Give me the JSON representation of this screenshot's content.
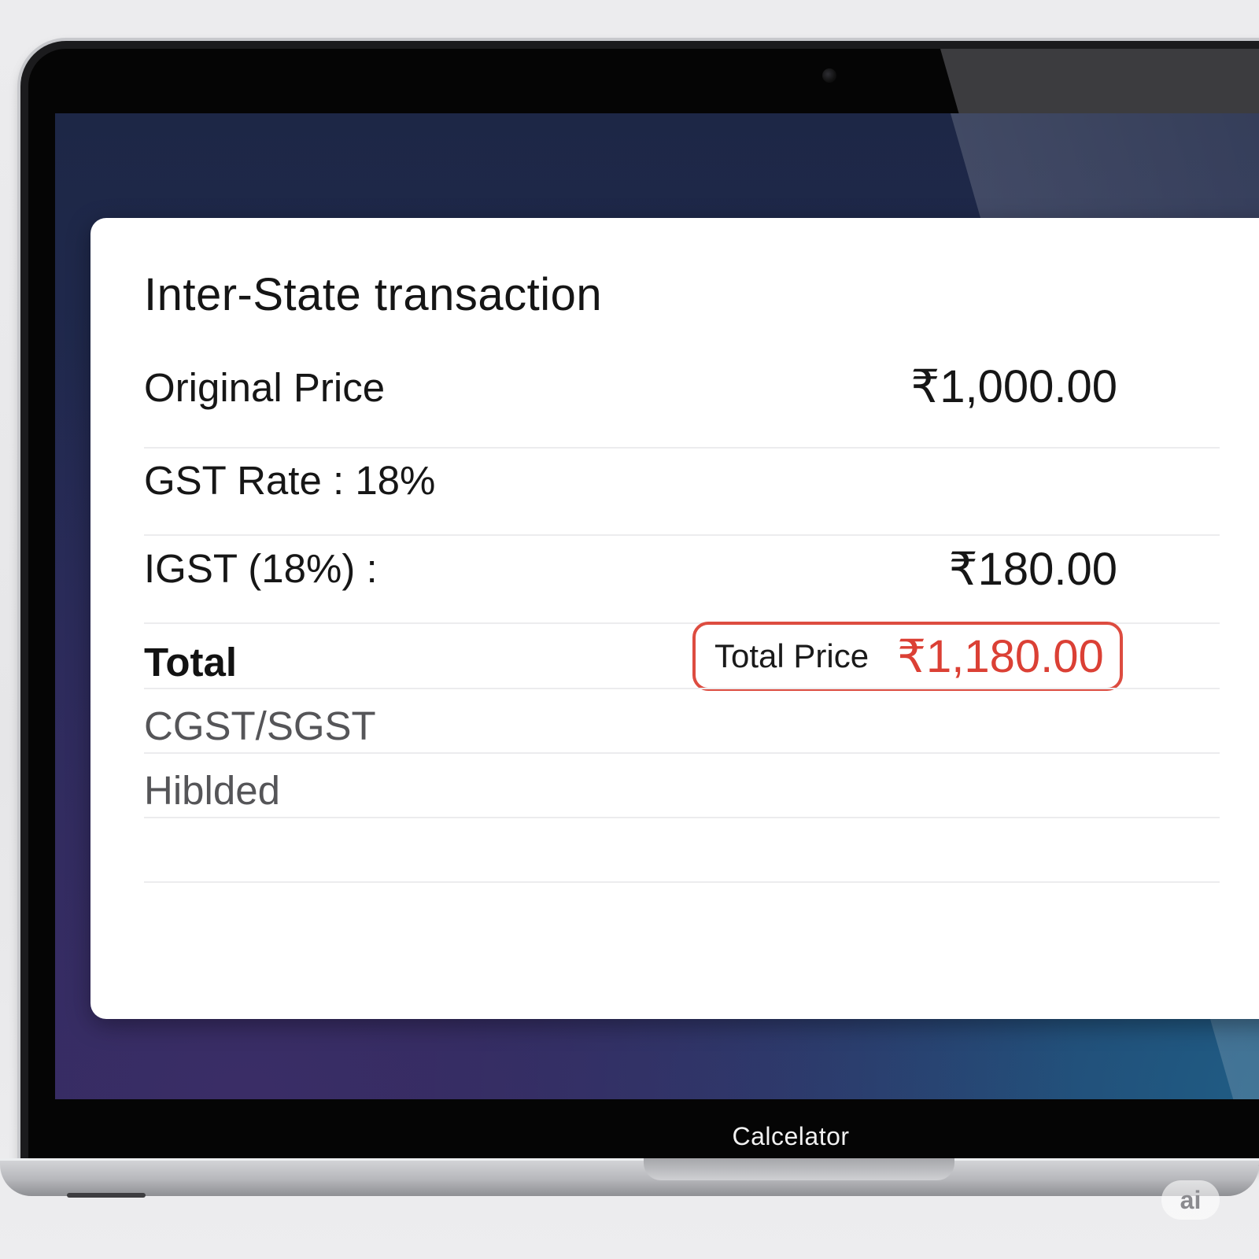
{
  "window": {
    "title": "Inter-State transaction"
  },
  "rows": {
    "original_price": {
      "label": "Original Price",
      "value": "₹1,000.00"
    },
    "gst_rate": {
      "label": "GST Rate : 18%"
    },
    "igst": {
      "label": "IGST (18%) :",
      "value": "₹180.00"
    },
    "total": {
      "label": "Total",
      "highlight_label": "Total Price",
      "highlight_value": "₹1,180.00"
    },
    "cgst_sgst": {
      "label": "CGST/SGST"
    },
    "hiblded": {
      "label": "Hiblded"
    }
  },
  "dock": {
    "app_label": "Calcelator"
  },
  "watermark": {
    "text": "ai"
  },
  "colors": {
    "accent": "#db4035",
    "card_background": "#ffffff",
    "wallpaper_top": "#1d2746",
    "wallpaper_bottom": "#2d2b5e"
  }
}
